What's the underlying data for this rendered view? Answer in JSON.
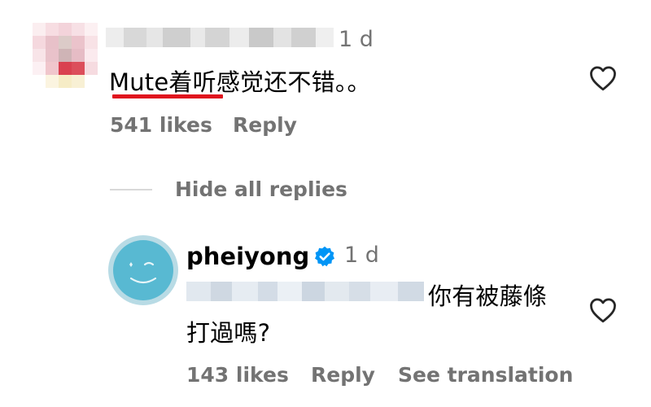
{
  "comment": {
    "timestamp": "1 d",
    "text_latin": "Mute",
    "text_cjk": "着听感觉还不错。。",
    "likes": "541 likes",
    "reply_label": "Reply",
    "highlight_color": "#e0141e"
  },
  "replies_toggle": {
    "label": "Hide all replies"
  },
  "reply": {
    "username": "pheiyong",
    "timestamp": "1 d",
    "text_line1": "你有被藤條",
    "text_line2": "打過嗎?",
    "likes": "143 likes",
    "reply_label": "Reply",
    "translation_label": "See translation",
    "verified_color": "#0095f6"
  },
  "icons": {
    "like": "heart-outline-icon",
    "verified": "verified-badge-icon"
  }
}
